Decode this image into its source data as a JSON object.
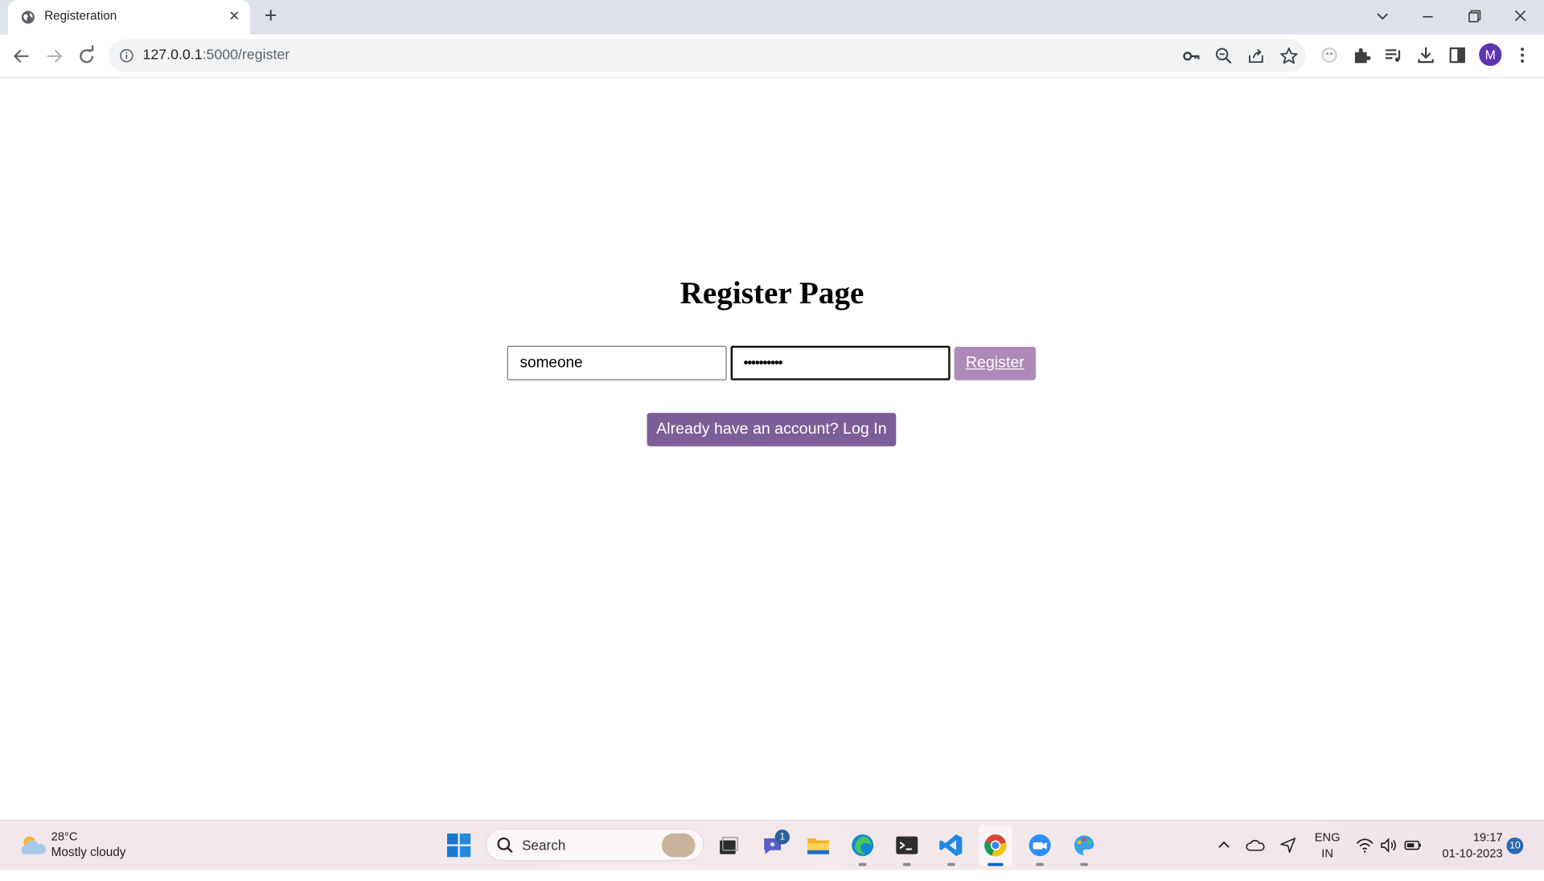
{
  "browser": {
    "tab_title": "Registeration",
    "tab_close": "✕",
    "new_tab": "+",
    "url_host": "127.0.0.1",
    "url_path": ":5000/register",
    "profile_initial": "M"
  },
  "page": {
    "title": "Register Page",
    "username_value": "someone",
    "password_value": "••••••••••",
    "register_label": "Register",
    "login_link_label": "Already have an account? Log In"
  },
  "taskbar": {
    "weather_temp": "28°C",
    "weather_desc": "Mostly cloudy",
    "search_placeholder": "Search",
    "teams_badge": "1",
    "lang_line1": "ENG",
    "lang_line2": "IN",
    "time": "19:17",
    "date": "01-10-2023",
    "notification_count": "10"
  },
  "colors": {
    "register_button": "#ae8ab8",
    "login_button": "#7d5e98",
    "avatar": "#5e35b1"
  }
}
